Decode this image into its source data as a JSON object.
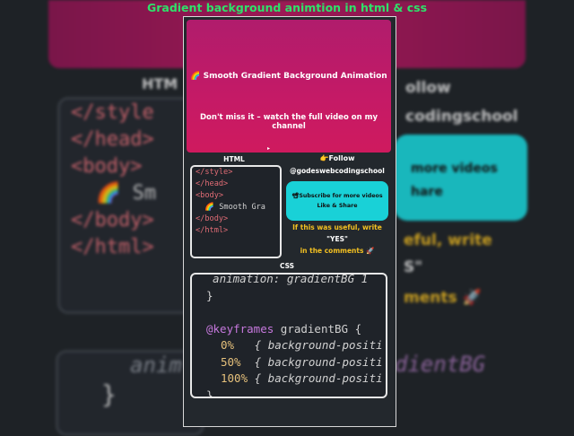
{
  "header": {
    "title": "Gradient background  animtion in html & css"
  },
  "preview": {
    "title": "🌈 Smooth Gradient Background Animation",
    "subtitle": "Don't miss it – watch the full video on my channel",
    "cursor": "▸"
  },
  "labels": {
    "html": "HTML",
    "css": "CSS"
  },
  "html_code": [
    "</style>",
    "</head>",
    "<body>",
    "  🌈 Smooth Gra",
    "</body>",
    "</html>"
  ],
  "social": {
    "follow": "👉Follow",
    "handle": "@godeswebcodingschool",
    "subscribe": "📽Subscribe for more videos",
    "like_share": "Like & Share",
    "useful_line1": "If this was useful, write",
    "useful_yes": "\"YES\"",
    "useful_line3": "in the comments 🚀"
  },
  "css_code": {
    "line1_prop": "  animation: gradientBG 1",
    "line2": "}",
    "line3_at": "@keyframes",
    "line3_name": " gradientBG {",
    "frames": [
      {
        "pct": "0%",
        "rest": "   { background-positi"
      },
      {
        "pct": "50%",
        "rest": "  { background-positi"
      },
      {
        "pct": "100%",
        "rest": " { background-positi"
      }
    ],
    "close": "}"
  },
  "backdrop": {
    "html_label": "HTM",
    "follow_text": "ollow",
    "handle_text": "codingschool",
    "more_videos": "more videos",
    "share": "hare",
    "useful": "eful, write",
    "yes": "S\"",
    "comments": "ments 🚀",
    "code_lines": [
      "</style",
      "</head>",
      "<body>",
      "🌈 Sm",
      "</body>",
      "</html>"
    ],
    "anim": "anim",
    "brace": "}",
    "gradient": "dientBG"
  },
  "colors": {
    "accent_green": "#2ee26a",
    "cyan": "#19d1d7",
    "yellow": "#f3c021",
    "magenta": "#c51a66"
  }
}
